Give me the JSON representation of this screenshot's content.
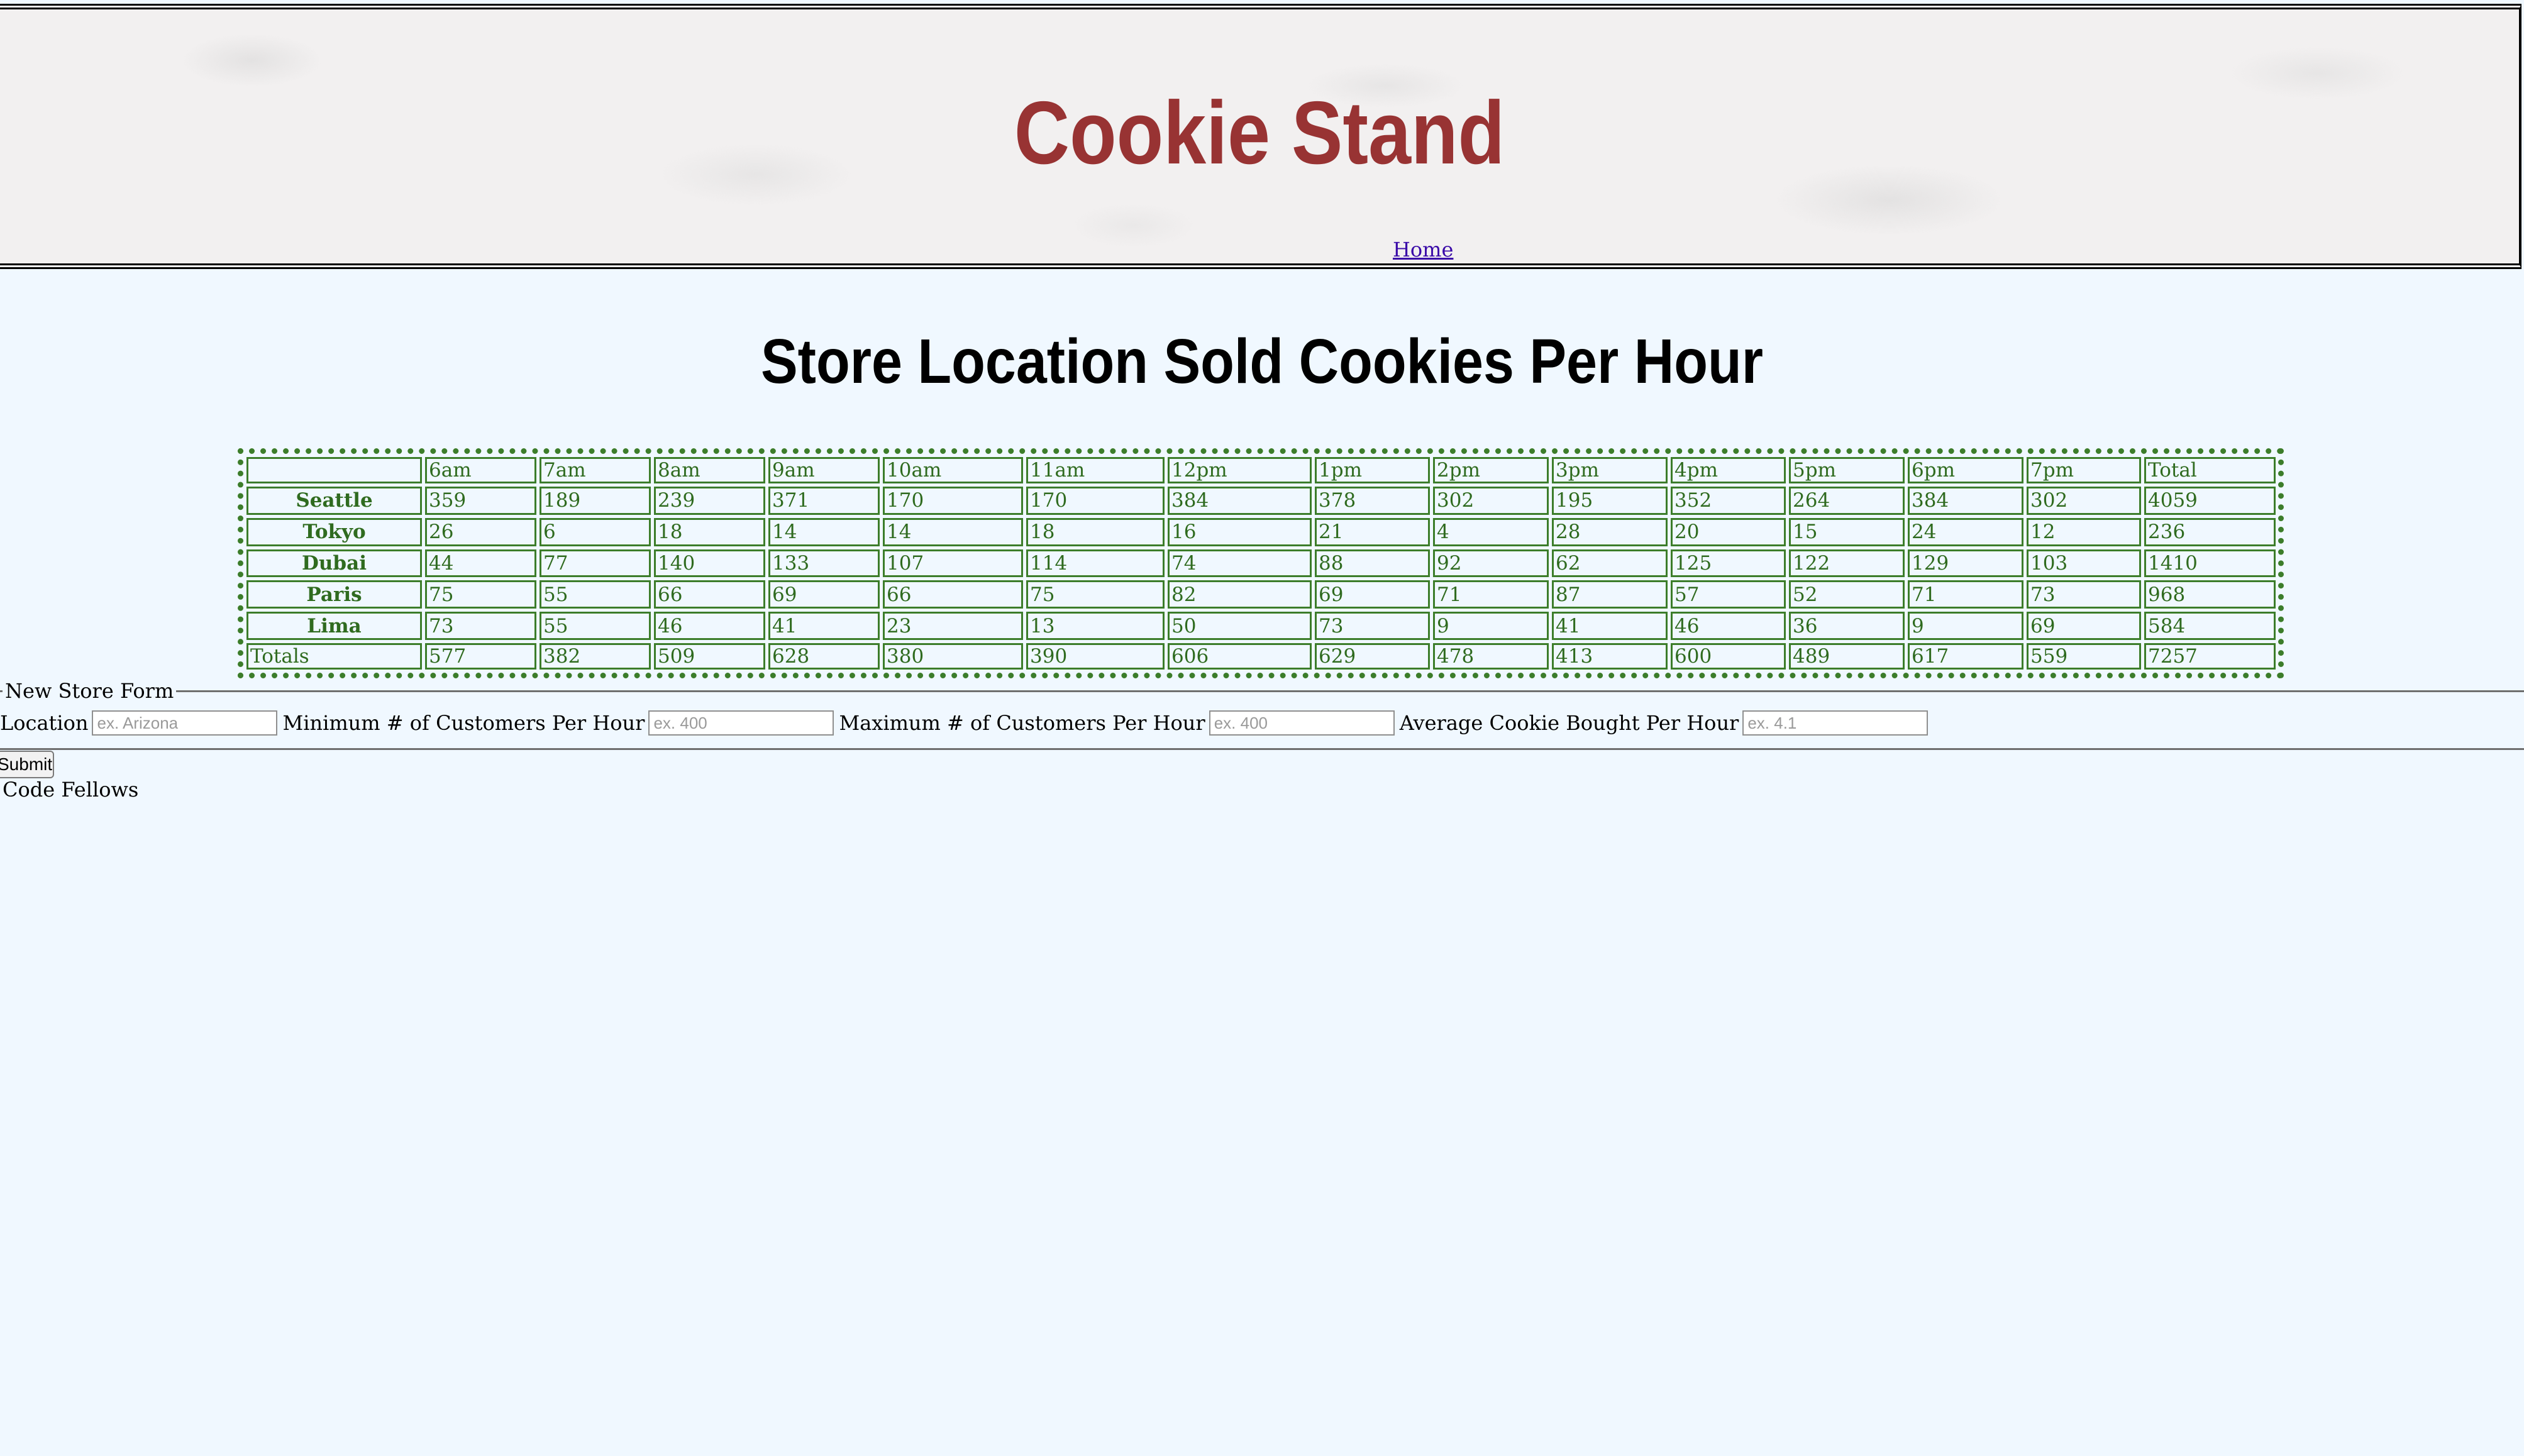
{
  "header": {
    "title": "Cookie Stand",
    "nav": {
      "home_label": "Home"
    }
  },
  "main": {
    "heading": "Store Location Sold Cookies Per Hour"
  },
  "sales_table": {
    "headers": [
      "",
      "6am",
      "7am",
      "8am",
      "9am",
      "10am",
      "11am",
      "12pm",
      "1pm",
      "2pm",
      "3pm",
      "4pm",
      "5pm",
      "6pm",
      "7pm",
      "Total"
    ],
    "rows": [
      {
        "store": "Seattle",
        "values": [
          "359",
          "189",
          "239",
          "371",
          "170",
          "170",
          "384",
          "378",
          "302",
          "195",
          "352",
          "264",
          "384",
          "302",
          "4059"
        ]
      },
      {
        "store": "Tokyo",
        "values": [
          "26",
          "6",
          "18",
          "14",
          "14",
          "18",
          "16",
          "21",
          "4",
          "28",
          "20",
          "15",
          "24",
          "12",
          "236"
        ]
      },
      {
        "store": "Dubai",
        "values": [
          "44",
          "77",
          "140",
          "133",
          "107",
          "114",
          "74",
          "88",
          "92",
          "62",
          "125",
          "122",
          "129",
          "103",
          "1410"
        ]
      },
      {
        "store": "Paris",
        "values": [
          "75",
          "55",
          "66",
          "69",
          "66",
          "75",
          "82",
          "69",
          "71",
          "87",
          "57",
          "52",
          "71",
          "73",
          "968"
        ]
      },
      {
        "store": "Lima",
        "values": [
          "73",
          "55",
          "46",
          "41",
          "23",
          "13",
          "50",
          "73",
          "9",
          "41",
          "46",
          "36",
          "9",
          "69",
          "584"
        ]
      }
    ],
    "totals": {
      "label": "Totals",
      "values": [
        "577",
        "382",
        "509",
        "628",
        "380",
        "390",
        "606",
        "629",
        "478",
        "413",
        "600",
        "489",
        "617",
        "559",
        "7257"
      ]
    }
  },
  "form": {
    "legend": "New Store Form",
    "location": {
      "label": "Location",
      "placeholder": "ex. Arizona",
      "value": ""
    },
    "min_customers": {
      "label": "Minimum # of Customers Per Hour",
      "placeholder": "ex. 400",
      "value": ""
    },
    "max_customers": {
      "label": "Maximum # of Customers Per Hour",
      "placeholder": "ex. 400",
      "value": ""
    },
    "avg_cookies": {
      "label": "Average Cookie Bought Per Hour",
      "placeholder": "ex. 4.1",
      "value": ""
    },
    "submit_label": "Submit"
  },
  "footer": {
    "text": "Code Fellows"
  },
  "colors": {
    "page_background": "#f0f8ff",
    "title": "#983333",
    "table_text": "#2f6b1f",
    "table_border": "#3c7d2a",
    "link": "#3a0aa8"
  }
}
